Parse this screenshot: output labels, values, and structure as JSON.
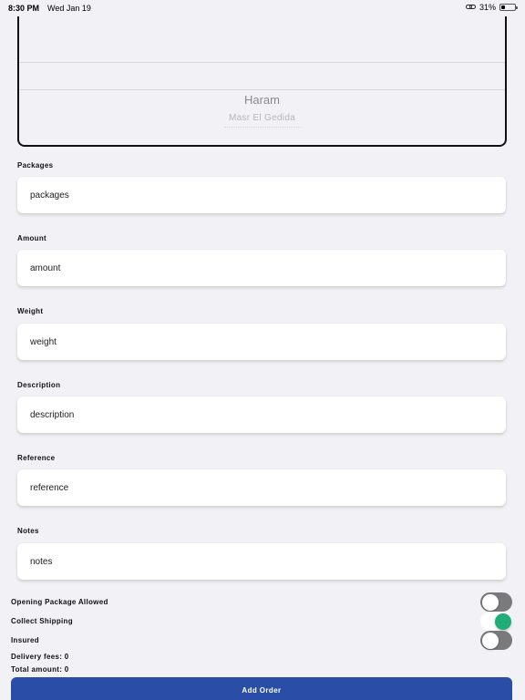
{
  "status_bar": {
    "time": "8:30 PM",
    "date": "Wed Jan 19",
    "battery": "31%",
    "battery_level": 0.31
  },
  "picker": {
    "selected": "Haram",
    "next": "Masr El Gedida"
  },
  "form": {
    "packages": {
      "label": "Packages",
      "placeholder": "packages"
    },
    "amount": {
      "label": "Amount",
      "placeholder": "amount"
    },
    "weight": {
      "label": "Weight",
      "placeholder": "weight"
    },
    "description": {
      "label": "Description",
      "placeholder": "description"
    },
    "reference": {
      "label": "Reference",
      "placeholder": "reference"
    },
    "notes": {
      "label": "Notes",
      "placeholder": "notes"
    }
  },
  "toggles": {
    "opening_package": {
      "label": "Opening Package Allowed",
      "on": false
    },
    "collect_shipping": {
      "label": "Collect Shipping",
      "on": true
    },
    "insured": {
      "label": "Insured",
      "on": false
    }
  },
  "summary": {
    "delivery_fees": "Delivery fees: 0",
    "total_amount": "Total amount: 0"
  },
  "actions": {
    "add_order": "Add Order"
  },
  "colors": {
    "background": "#f2f1f6",
    "button": "#2a4ea8",
    "switch_on": "#1fae78",
    "switch_off": "#7a7a7d"
  }
}
